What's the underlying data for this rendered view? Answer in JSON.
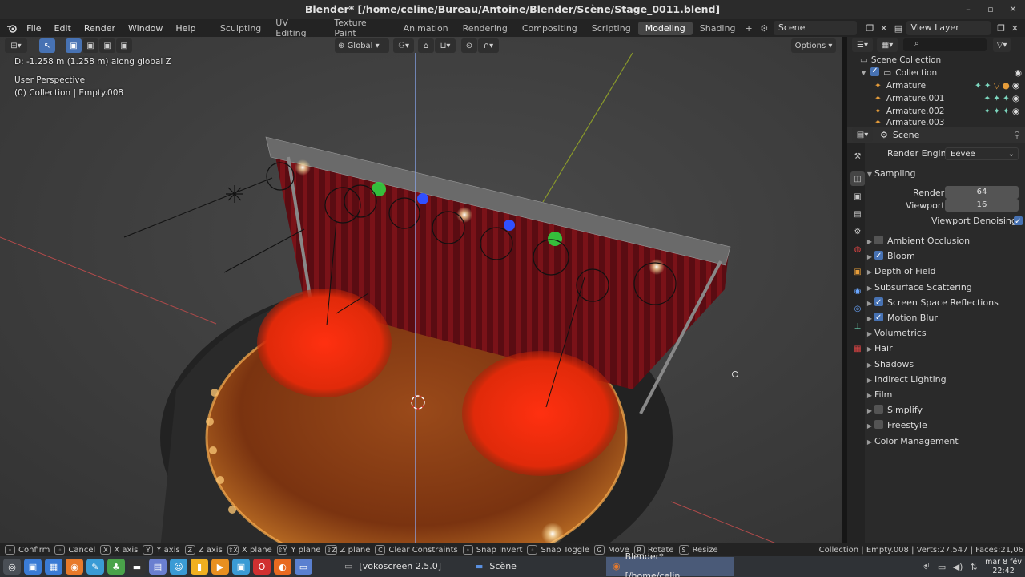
{
  "title": "Blender* [/home/celine/Bureau/Antoine/Blender/Scène/Stage_0011.blend]",
  "window_controls": [
    "–",
    "▫",
    "✕"
  ],
  "menus": [
    "File",
    "Edit",
    "Render",
    "Window",
    "Help"
  ],
  "workspaces": [
    "Sculpting",
    "UV Editing",
    "Texture Paint",
    "Animation",
    "Rendering",
    "Compositing",
    "Scripting",
    "Modeling",
    "Shading"
  ],
  "active_workspace": "Modeling",
  "scene_field": "Scene",
  "view_layer_field": "View Layer",
  "viewport": {
    "transform_orientation": "Global",
    "options_label": "Options",
    "operator_info": "D: -1.258 m (1.258 m) along global Z",
    "view_name": "User Perspective",
    "context_info": "(0) Collection | Empty.008"
  },
  "outliner": {
    "search_placeholder": "",
    "root": "Scene Collection",
    "collection": "Collection",
    "items": [
      "Armature",
      "Armature.001",
      "Armature.002",
      "Armature.003"
    ]
  },
  "properties": {
    "context_name": "Scene",
    "render_engine_label": "Render Engine",
    "render_engine": "Eevee",
    "sampling_label": "Sampling",
    "render_label": "Render",
    "render_samples": "64",
    "viewport_label": "Viewport",
    "viewport_samples": "16",
    "denoise_label": "Viewport Denoising",
    "panels": [
      {
        "label": "Ambient Occlusion",
        "checkbox": true,
        "checked": false
      },
      {
        "label": "Bloom",
        "checkbox": true,
        "checked": true
      },
      {
        "label": "Depth of Field",
        "checkbox": false
      },
      {
        "label": "Subsurface Scattering",
        "checkbox": false
      },
      {
        "label": "Screen Space Reflections",
        "checkbox": true,
        "checked": true
      },
      {
        "label": "Motion Blur",
        "checkbox": true,
        "checked": true
      },
      {
        "label": "Volumetrics",
        "checkbox": false
      },
      {
        "label": "Hair",
        "checkbox": false
      },
      {
        "label": "Shadows",
        "checkbox": false
      },
      {
        "label": "Indirect Lighting",
        "checkbox": false
      },
      {
        "label": "Film",
        "checkbox": false
      },
      {
        "label": "Simplify",
        "checkbox": true,
        "checked": false
      },
      {
        "label": "Freestyle",
        "checkbox": true,
        "checked": false
      },
      {
        "label": "Color Management",
        "checkbox": false
      }
    ]
  },
  "statusbar": {
    "items": [
      {
        "key": "",
        "label": "Confirm"
      },
      {
        "key": "",
        "label": "Cancel"
      },
      {
        "key": "X",
        "label": "X axis"
      },
      {
        "key": "Y",
        "label": "Y axis"
      },
      {
        "key": "Z",
        "label": "Z axis"
      },
      {
        "key": "⇧X",
        "label": "X plane"
      },
      {
        "key": "⇧Y",
        "label": "Y plane"
      },
      {
        "key": "⇧Z",
        "label": "Z plane"
      },
      {
        "key": "C",
        "label": "Clear Constraints"
      },
      {
        "key": "",
        "label": "Snap Invert"
      },
      {
        "key": "",
        "label": "Snap Toggle"
      },
      {
        "key": "G",
        "label": "Move"
      },
      {
        "key": "R",
        "label": "Rotate"
      },
      {
        "key": "S",
        "label": "Resize"
      }
    ],
    "stats": "Collection | Empty.008 | Verts:27,547 | Faces:21,06"
  },
  "taskbar": {
    "task1": "[vokoscreen 2.5.0]",
    "task2": "Scène",
    "task3": "Blender* [/home/celin...",
    "date": "mar 8 fév",
    "time": "22:42"
  }
}
